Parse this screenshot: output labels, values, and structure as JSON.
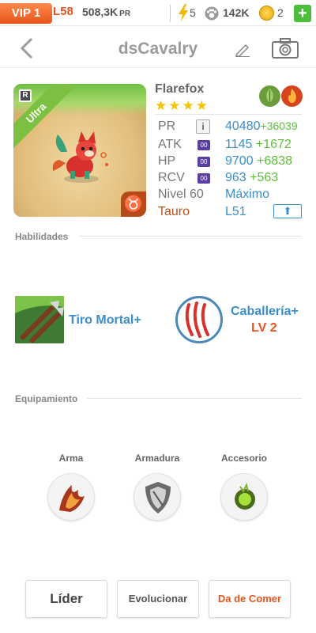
{
  "status_bar": {
    "vip": "VIP 1",
    "level": "L58",
    "pr_total": "508,3K",
    "pr_unit": "PR",
    "energy": "5",
    "paws": "142K",
    "coins": "2",
    "add": "+"
  },
  "header": {
    "title": "dsCavalry"
  },
  "monster": {
    "name": "Flarefox",
    "rank_letter": "R",
    "rarity": "Ultra",
    "zodiac_symbol": "♉",
    "stars": "★★★★",
    "elements": [
      "leaf-element-icon",
      "fire-element-icon"
    ],
    "stats": [
      {
        "label": "PR",
        "value": "40480",
        "bonus": "+36039"
      },
      {
        "label": "ATK",
        "value": "1145",
        "bonus": "+1672"
      },
      {
        "label": "HP",
        "value": "9700",
        "bonus": "+6838"
      },
      {
        "label": "RCV",
        "value": "963",
        "bonus": "+563"
      }
    ],
    "tag": "00",
    "info": "i",
    "level_label": "Nivel 60",
    "level_value": "Máximo",
    "zodiac_label": "Tauro",
    "zodiac_level": "L51"
  },
  "sections": {
    "skills": "Habilidades",
    "equipment": "Equipamiento"
  },
  "skills": [
    {
      "name": "Tiro Mortal+"
    },
    {
      "name": "Caballería+",
      "level": "LV 2"
    }
  ],
  "equipment": [
    {
      "label": "Arma"
    },
    {
      "label": "Armadura"
    },
    {
      "label": "Accesorio"
    }
  ],
  "buttons": {
    "leader": "Líder",
    "evolve": "Evolucionar",
    "feed": "Da de Comer"
  },
  "colors": {
    "accent_blue": "#3a8fc9",
    "bonus_green": "#5cbd3b",
    "orange": "#e8541c"
  }
}
